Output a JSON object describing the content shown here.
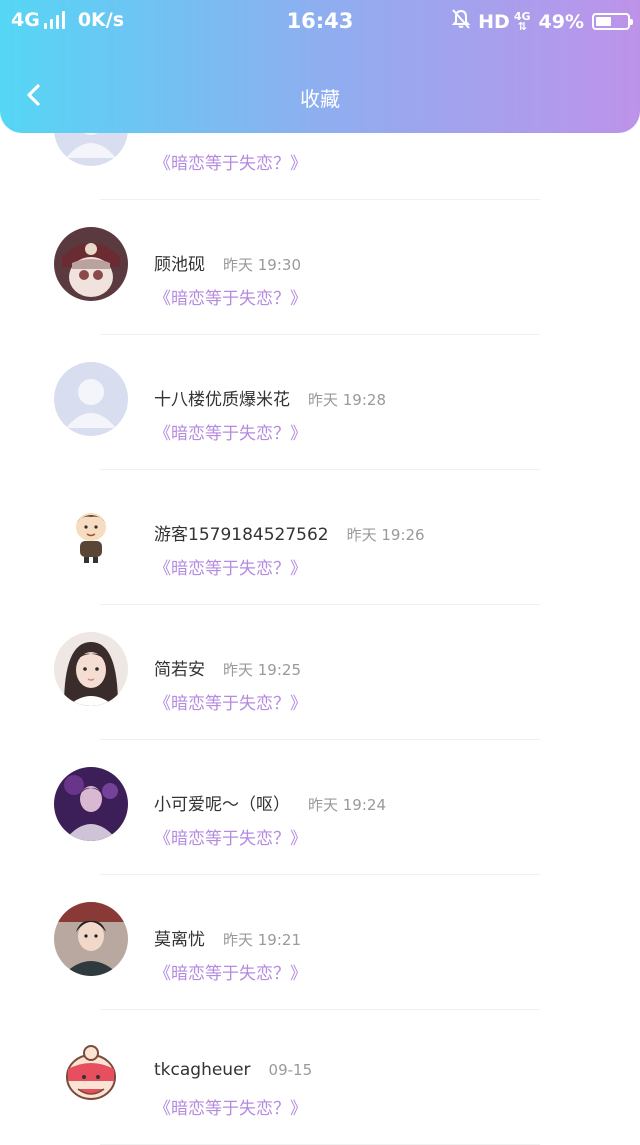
{
  "status_bar": {
    "network": "4G",
    "speed": "0K/s",
    "time": "16:43",
    "hd": "HD",
    "net_type": "4G",
    "battery": "49%",
    "battery_level": 0.49
  },
  "header": {
    "title": "收藏",
    "back_icon": "chevron-left-icon",
    "gradient": [
      "#55d6f5",
      "#bd93ea"
    ]
  },
  "accent_color": "#b58be0",
  "favorites": [
    {
      "name": "",
      "time": "",
      "post": "《暗恋等于失恋？》",
      "avatar": "default-avatar"
    },
    {
      "name": "顾池砚",
      "time": "昨天 19:30",
      "post": "《暗恋等于失恋？》",
      "avatar": "anime-avatar"
    },
    {
      "name": "十八楼优质爆米花",
      "time": "昨天 19:28",
      "post": "《暗恋等于失恋？》",
      "avatar": "default-avatar"
    },
    {
      "name": "游客1579184527562",
      "time": "昨天 19:26",
      "post": "《暗恋等于失恋？》",
      "avatar": "cartoon-boy-avatar"
    },
    {
      "name": "简若安",
      "time": "昨天 19:25",
      "post": "《暗恋等于失恋？》",
      "avatar": "girl-photo-avatar"
    },
    {
      "name": "小可爱呢～（呕）",
      "time": "昨天 19:24",
      "post": "《暗恋等于失恋？》",
      "avatar": "purple-photo-avatar"
    },
    {
      "name": "莫离忧",
      "time": "昨天 19:21",
      "post": "《暗恋等于失恋？》",
      "avatar": "boy-photo-avatar"
    },
    {
      "name": "tkcagheuer",
      "time": "09-15",
      "post": "《暗恋等于失恋？》",
      "avatar": "cartoon-blush-avatar"
    }
  ]
}
